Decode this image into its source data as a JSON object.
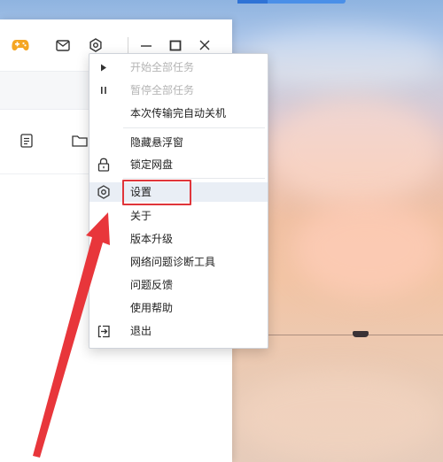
{
  "window": {
    "title_bar_icons": [
      {
        "name": "game-controller-icon",
        "color": "#f5a623"
      },
      {
        "name": "mail-icon"
      },
      {
        "name": "settings-icon"
      },
      {
        "name": "minimize-icon"
      },
      {
        "name": "maximize-icon"
      },
      {
        "name": "close-icon"
      }
    ],
    "toolbar_icons": [
      "document-icon",
      "folder-icon"
    ]
  },
  "context_menu": {
    "items": [
      {
        "label": "开始全部任务",
        "icon": "play-icon",
        "disabled": true
      },
      {
        "label": "暂停全部任务",
        "icon": "pause-icon",
        "disabled": true
      },
      {
        "label": "本次传输完自动关机",
        "icon": "",
        "disabled": false
      },
      {
        "label": "隐藏悬浮窗",
        "icon": "",
        "disabled": false
      },
      {
        "label": "锁定网盘",
        "icon": "lock-icon",
        "disabled": false
      },
      {
        "label": "设置",
        "icon": "settings-icon",
        "disabled": false,
        "hovered": true,
        "highlighted": true
      },
      {
        "label": "关于",
        "icon": "",
        "disabled": false
      },
      {
        "label": "版本升级",
        "icon": "",
        "disabled": false
      },
      {
        "label": "网络问题诊断工具",
        "icon": "",
        "disabled": false
      },
      {
        "label": "问题反馈",
        "icon": "",
        "disabled": false
      },
      {
        "label": "使用帮助",
        "icon": "",
        "disabled": false
      },
      {
        "label": "退出",
        "icon": "exit-icon",
        "disabled": false
      }
    ]
  },
  "annotation": {
    "highlight_color": "#e0353a",
    "arrow_color": "#e8363b"
  }
}
